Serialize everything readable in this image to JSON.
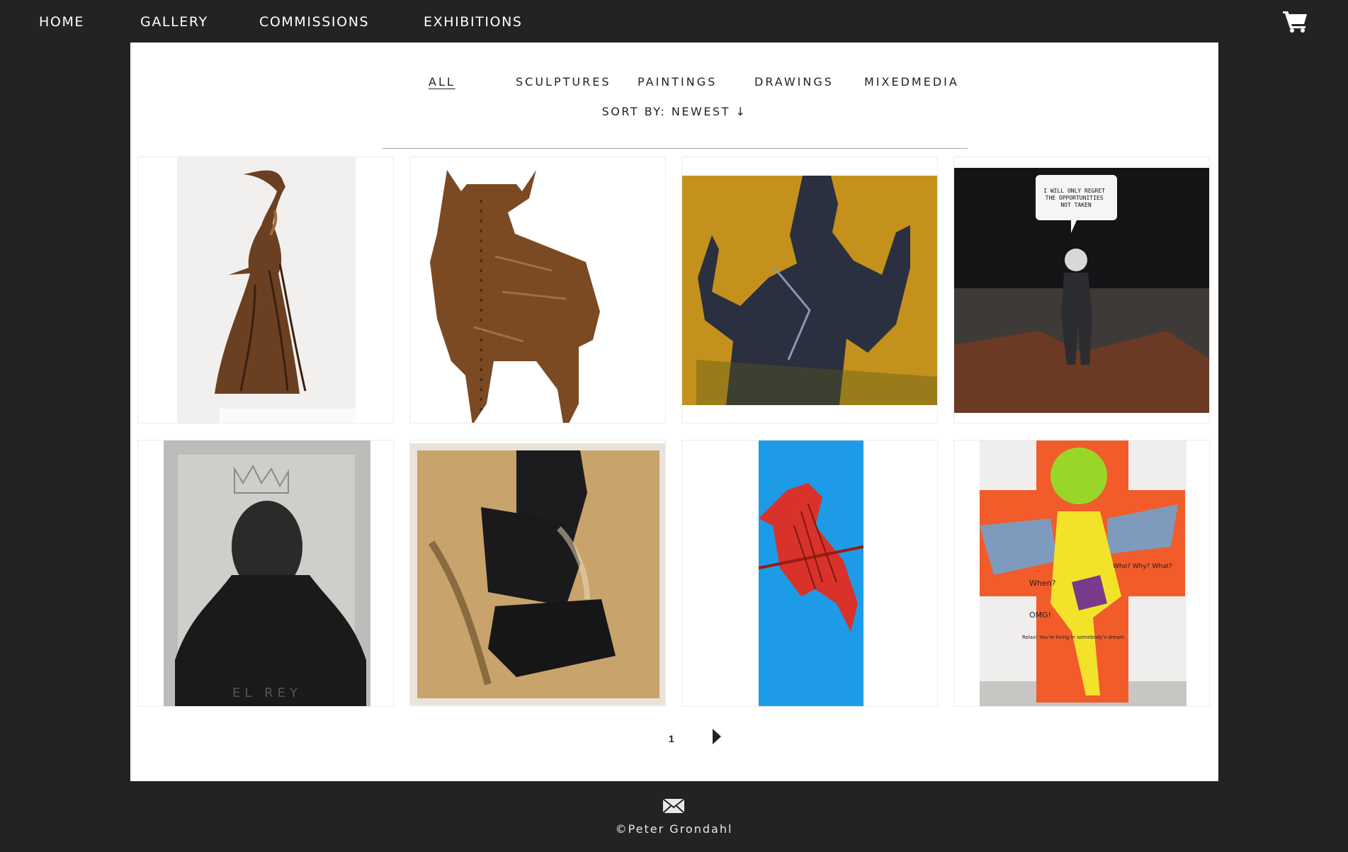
{
  "nav": {
    "items": [
      "HOME",
      "GALLERY",
      "COMMISSIONS",
      "EXHIBITIONS"
    ],
    "cart_icon": "shopping-cart-icon"
  },
  "gallery": {
    "filters": [
      "ALL",
      "SCULPTURES",
      "PAINTINGS",
      "DRAWINGS",
      "MIXEDMEDIA"
    ],
    "active_filter": "ALL",
    "sort_label": "SORT BY:",
    "sort_value": "NEWEST ↓",
    "artworks": [
      {
        "type": "bronze sculpture of dancer in gown"
      },
      {
        "type": "rusted metal bull"
      },
      {
        "type": "painted figure on ochre background"
      },
      {
        "type": "astronaut painting with speech bubble",
        "speech": "I WILL ONLY REGRET THE OPPORTUNITIES NOT TAKEN"
      },
      {
        "type": "charcoal portrait of crowned figure",
        "caption": "EL REY"
      },
      {
        "type": "painting of torso in black clothing"
      },
      {
        "type": "red figure on blue background"
      },
      {
        "type": "green winged figure on orange cross",
        "texts": [
          "When?",
          "Who? Why? What?",
          "OMG!",
          "Relax! You're living in somebody's dream."
        ]
      }
    ]
  },
  "pagination": {
    "current_page": "1",
    "next_icon": "next-arrow-icon"
  },
  "footer": {
    "mail_icon": "envelope-icon",
    "copyright": "©Peter Grondahl"
  },
  "colors": {
    "background": "#232323",
    "panel": "#ffffff",
    "text_dark": "#222222"
  }
}
